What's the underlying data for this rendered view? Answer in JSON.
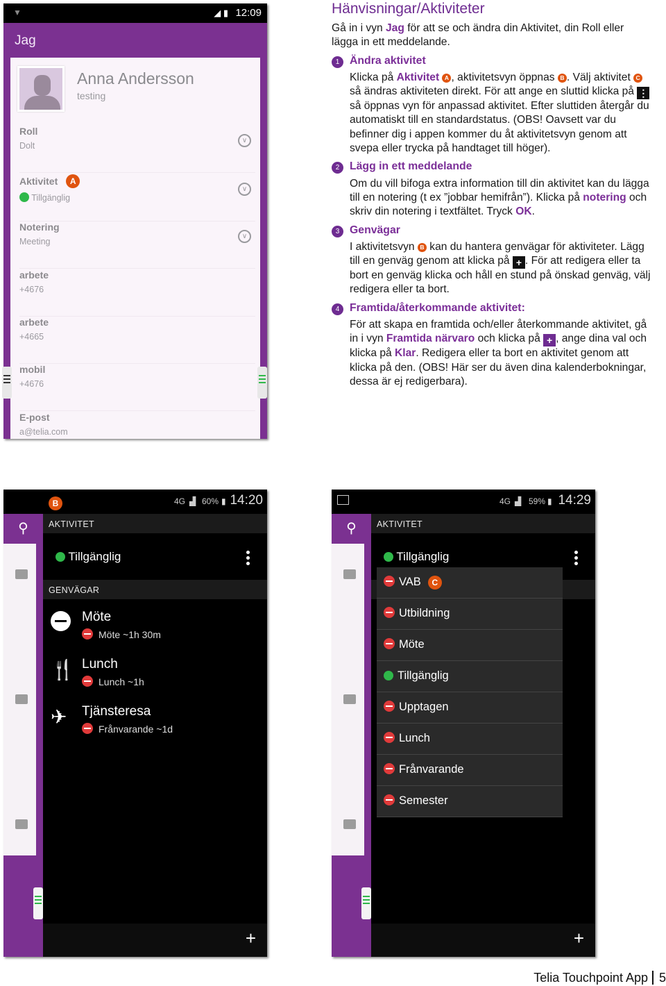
{
  "phone_me": {
    "status_time": "12:09",
    "title": "Jag",
    "name": "Anna Andersson",
    "subtitle": "testing",
    "rows": [
      {
        "label": "Roll",
        "value": "Dolt",
        "expand": true
      },
      {
        "label": "Aktivitet",
        "value": "Tillgänglig",
        "badge": "A",
        "expand": true
      },
      {
        "label": "Notering",
        "value": "Meeting",
        "expand": true
      },
      {
        "label": "arbete",
        "value": "+4676"
      },
      {
        "label": "arbete",
        "value": "+4665"
      },
      {
        "label": "mobil",
        "value": "+4676"
      },
      {
        "label": "E-post",
        "value": "a@telia.com"
      }
    ]
  },
  "phone_activity": {
    "badge": "B",
    "network": "4G",
    "battery": "60%",
    "status_time": "14:20",
    "header": "AKTIVITET",
    "current": "Tillgänglig",
    "shortcuts_header": "GENVÄGAR",
    "shortcuts": [
      {
        "title": "Möte",
        "detail": "Möte ~1h 30m",
        "icon": "minus-circle-icon"
      },
      {
        "title": "Lunch",
        "detail": "Lunch ~1h",
        "icon": "cutlery-icon"
      },
      {
        "title": "Tjänsteresa",
        "detail": "Frånvarande ~1d",
        "icon": "airplane-icon"
      }
    ],
    "add": "+"
  },
  "phone_select": {
    "network": "4G",
    "battery": "59%",
    "status_time": "14:29",
    "header": "AKTIVITET",
    "current": "Tillgänglig",
    "badge": "C",
    "options": [
      {
        "label": "VAB",
        "status": "busy"
      },
      {
        "label": "Utbildning",
        "status": "busy"
      },
      {
        "label": "Möte",
        "status": "busy"
      },
      {
        "label": "Tillgänglig",
        "status": "available"
      },
      {
        "label": "Upptagen",
        "status": "busy"
      },
      {
        "label": "Lunch",
        "status": "busy"
      },
      {
        "label": "Frånvarande",
        "status": "busy"
      },
      {
        "label": "Semester",
        "status": "busy"
      }
    ],
    "add": "+"
  },
  "doc": {
    "title": "Hänvisningar/Aktiviteter",
    "intro": [
      "Gå in i vyn ",
      {
        "b": "Jag"
      },
      " för att se och ändra din Aktivitet, din Roll eller lägga in ett meddelande."
    ],
    "sections": [
      {
        "num": "1",
        "heading": "Ändra aktivitet",
        "body": [
          "Klicka på ",
          {
            "b": "Aktivitet"
          },
          " ",
          {
            "badge": "A"
          },
          ", aktivitetsvyn öppnas ",
          {
            "badge": "B"
          },
          ". Välj aktivitet ",
          {
            "badge": "C"
          },
          " så ändras aktiviteten direkt. För att ange en sluttid klicka på ",
          {
            "icon": "more"
          },
          " så öppnas vyn för anpassad aktivitet. Efter sluttiden återgår du automatiskt till en standardstatus. (OBS! Oavsett var du befinner dig i appen kommer du åt aktivitetsvyn genom att svepa eller trycka på handtaget till höger)."
        ]
      },
      {
        "num": "2",
        "heading": "Lägg in ett meddelande",
        "body": [
          "Om du vill bifoga extra information till din aktivitet kan du lägga till en notering (t ex ”jobbar hemifrån”). Klicka på ",
          {
            "b": "notering"
          },
          " och skriv din notering i textfältet. Tryck ",
          {
            "b": "OK"
          },
          "."
        ]
      },
      {
        "num": "3",
        "heading": "Genvägar",
        "body": [
          "I aktivitetsvyn ",
          {
            "badge": "B"
          },
          " kan du hantera genvägar för aktiviteter. Lägg till en genväg genom att klicka på ",
          {
            "icon": "plus"
          },
          ". För att redigera eller ta bort en genväg klicka och håll en stund på önskad genväg, välj redigera eller ta bort."
        ]
      },
      {
        "num": "4",
        "heading": "Framtida/återkommande aktivitet:",
        "body": [
          "För att skapa en framtida och/eller återkommande aktivitet, gå in i vyn ",
          {
            "b": "Framtida närvaro"
          },
          " och klicka på ",
          {
            "icon": "plus-purple"
          },
          ", ange dina val och klicka på ",
          {
            "b": "Klar"
          },
          ". Redigera eller ta bort en aktivitet genom att klicka på den. (OBS! Här ser du även dina kalenderbokningar, dessa är ej redigerbara)."
        ]
      }
    ]
  },
  "footer": {
    "app": "Telia Touchpoint App",
    "page": "5"
  },
  "colors": {
    "purple": "#7b3191",
    "badge_orange": "#e0540f",
    "available": "#2fb84a",
    "busy": "#e03a3a"
  }
}
